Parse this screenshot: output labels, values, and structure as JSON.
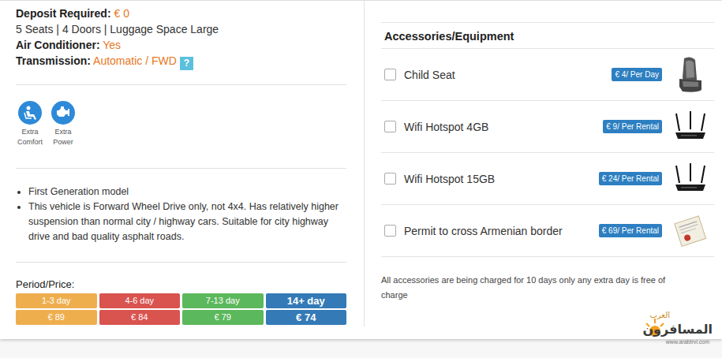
{
  "specs": {
    "deposit_label": "Deposit Required:",
    "deposit_value": "€ 0",
    "capacity": "5 Seats | 4 Doors | Luggage Space Large",
    "ac_label": "Air Conditioner:",
    "ac_value": "Yes",
    "transmission_label": "Transmission:",
    "transmission_value": "Automatic / FWD",
    "help": "?"
  },
  "features": [
    {
      "label": "Extra Comfort"
    },
    {
      "label": "Extra Power"
    }
  ],
  "notes": [
    "First Generation model",
    "This vehicle is Forward Wheel Drive only, not 4x4. Has relatively higher suspension than normal city / highway cars. Suitable for city highway drive and bad quality asphalt roads."
  ],
  "period": {
    "title": "Period/Price:",
    "tiers": [
      {
        "period": "1-3 day",
        "price": "€ 89",
        "color": "#efae4e"
      },
      {
        "period": "4-6 day",
        "price": "€ 84",
        "color": "#d9534f"
      },
      {
        "period": "7-13 day",
        "price": "€ 79",
        "color": "#5cb85c"
      },
      {
        "period": "14+ day",
        "price": "€ 74",
        "color": "#337ab7"
      }
    ]
  },
  "accessories": {
    "title": "Accessories/Equipment",
    "items": [
      {
        "name": "Child Seat",
        "price": "€ 4/ Per Day",
        "checked": false,
        "kind": "seat"
      },
      {
        "name": "Wifi Hotspot 4GB",
        "price": "€ 9/ Per Rental",
        "checked": false,
        "kind": "router"
      },
      {
        "name": "Wifi Hotspot 15GB",
        "price": "€ 24/ Per Rental",
        "checked": false,
        "kind": "router"
      },
      {
        "name": "Permit to cross Armenian border",
        "price": "€ 69/ Per Rental",
        "checked": false,
        "kind": "permit"
      }
    ],
    "note": "All accessories are being charged for 10 days only any extra day is free of charge"
  },
  "watermark": {
    "small": "العرب",
    "name": "المسافرون",
    "url": "www.arabtrvl.com"
  }
}
